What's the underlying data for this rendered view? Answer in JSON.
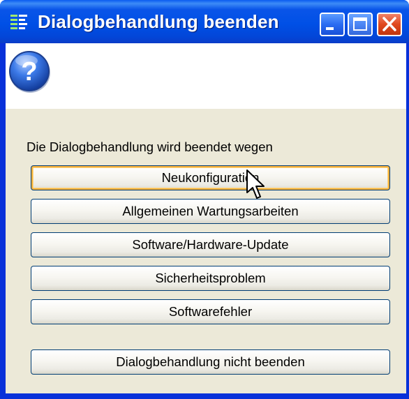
{
  "window": {
    "title": "Dialogbehandlung beenden",
    "title_icon": "list-lines-icon",
    "controls": {
      "minimize": "minimize-icon",
      "maximize": "maximize-icon",
      "close": "close-icon"
    }
  },
  "dialog": {
    "icon": "question-icon",
    "prompt": "Die Dialogbehandlung wird beendet wegen",
    "buttons": [
      {
        "label": "Neukonfiguration",
        "state": "hover"
      },
      {
        "label": "Allgemeinen Wartungsarbeiten"
      },
      {
        "label": "Software/Hardware-Update"
      },
      {
        "label": "Sicherheitsproblem"
      },
      {
        "label": "Softwarefehler"
      }
    ],
    "cancel_button": "Dialogbehandlung nicht beenden"
  },
  "colors": {
    "titlebar": "#0050e6",
    "dialog_background": "#ece9d8",
    "hover_outline": "#f9b23c",
    "button_border": "#003c74",
    "close_button": "#e0481e"
  }
}
